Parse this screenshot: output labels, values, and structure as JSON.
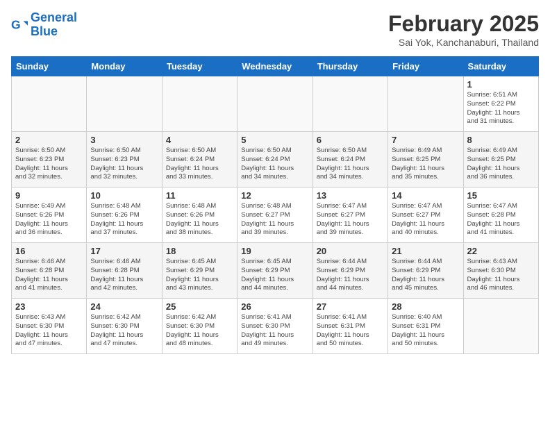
{
  "header": {
    "logo_line1": "General",
    "logo_line2": "Blue",
    "title": "February 2025",
    "subtitle": "Sai Yok, Kanchanaburi, Thailand"
  },
  "weekdays": [
    "Sunday",
    "Monday",
    "Tuesday",
    "Wednesday",
    "Thursday",
    "Friday",
    "Saturday"
  ],
  "weeks": [
    [
      {
        "day": "",
        "info": ""
      },
      {
        "day": "",
        "info": ""
      },
      {
        "day": "",
        "info": ""
      },
      {
        "day": "",
        "info": ""
      },
      {
        "day": "",
        "info": ""
      },
      {
        "day": "",
        "info": ""
      },
      {
        "day": "1",
        "info": "Sunrise: 6:51 AM\nSunset: 6:22 PM\nDaylight: 11 hours\nand 31 minutes."
      }
    ],
    [
      {
        "day": "2",
        "info": "Sunrise: 6:50 AM\nSunset: 6:23 PM\nDaylight: 11 hours\nand 32 minutes."
      },
      {
        "day": "3",
        "info": "Sunrise: 6:50 AM\nSunset: 6:23 PM\nDaylight: 11 hours\nand 32 minutes."
      },
      {
        "day": "4",
        "info": "Sunrise: 6:50 AM\nSunset: 6:24 PM\nDaylight: 11 hours\nand 33 minutes."
      },
      {
        "day": "5",
        "info": "Sunrise: 6:50 AM\nSunset: 6:24 PM\nDaylight: 11 hours\nand 34 minutes."
      },
      {
        "day": "6",
        "info": "Sunrise: 6:50 AM\nSunset: 6:24 PM\nDaylight: 11 hours\nand 34 minutes."
      },
      {
        "day": "7",
        "info": "Sunrise: 6:49 AM\nSunset: 6:25 PM\nDaylight: 11 hours\nand 35 minutes."
      },
      {
        "day": "8",
        "info": "Sunrise: 6:49 AM\nSunset: 6:25 PM\nDaylight: 11 hours\nand 36 minutes."
      }
    ],
    [
      {
        "day": "9",
        "info": "Sunrise: 6:49 AM\nSunset: 6:26 PM\nDaylight: 11 hours\nand 36 minutes."
      },
      {
        "day": "10",
        "info": "Sunrise: 6:48 AM\nSunset: 6:26 PM\nDaylight: 11 hours\nand 37 minutes."
      },
      {
        "day": "11",
        "info": "Sunrise: 6:48 AM\nSunset: 6:26 PM\nDaylight: 11 hours\nand 38 minutes."
      },
      {
        "day": "12",
        "info": "Sunrise: 6:48 AM\nSunset: 6:27 PM\nDaylight: 11 hours\nand 39 minutes."
      },
      {
        "day": "13",
        "info": "Sunrise: 6:47 AM\nSunset: 6:27 PM\nDaylight: 11 hours\nand 39 minutes."
      },
      {
        "day": "14",
        "info": "Sunrise: 6:47 AM\nSunset: 6:27 PM\nDaylight: 11 hours\nand 40 minutes."
      },
      {
        "day": "15",
        "info": "Sunrise: 6:47 AM\nSunset: 6:28 PM\nDaylight: 11 hours\nand 41 minutes."
      }
    ],
    [
      {
        "day": "16",
        "info": "Sunrise: 6:46 AM\nSunset: 6:28 PM\nDaylight: 11 hours\nand 41 minutes."
      },
      {
        "day": "17",
        "info": "Sunrise: 6:46 AM\nSunset: 6:28 PM\nDaylight: 11 hours\nand 42 minutes."
      },
      {
        "day": "18",
        "info": "Sunrise: 6:45 AM\nSunset: 6:29 PM\nDaylight: 11 hours\nand 43 minutes."
      },
      {
        "day": "19",
        "info": "Sunrise: 6:45 AM\nSunset: 6:29 PM\nDaylight: 11 hours\nand 44 minutes."
      },
      {
        "day": "20",
        "info": "Sunrise: 6:44 AM\nSunset: 6:29 PM\nDaylight: 11 hours\nand 44 minutes."
      },
      {
        "day": "21",
        "info": "Sunrise: 6:44 AM\nSunset: 6:29 PM\nDaylight: 11 hours\nand 45 minutes."
      },
      {
        "day": "22",
        "info": "Sunrise: 6:43 AM\nSunset: 6:30 PM\nDaylight: 11 hours\nand 46 minutes."
      }
    ],
    [
      {
        "day": "23",
        "info": "Sunrise: 6:43 AM\nSunset: 6:30 PM\nDaylight: 11 hours\nand 47 minutes."
      },
      {
        "day": "24",
        "info": "Sunrise: 6:42 AM\nSunset: 6:30 PM\nDaylight: 11 hours\nand 47 minutes."
      },
      {
        "day": "25",
        "info": "Sunrise: 6:42 AM\nSunset: 6:30 PM\nDaylight: 11 hours\nand 48 minutes."
      },
      {
        "day": "26",
        "info": "Sunrise: 6:41 AM\nSunset: 6:30 PM\nDaylight: 11 hours\nand 49 minutes."
      },
      {
        "day": "27",
        "info": "Sunrise: 6:41 AM\nSunset: 6:31 PM\nDaylight: 11 hours\nand 50 minutes."
      },
      {
        "day": "28",
        "info": "Sunrise: 6:40 AM\nSunset: 6:31 PM\nDaylight: 11 hours\nand 50 minutes."
      },
      {
        "day": "",
        "info": ""
      }
    ]
  ]
}
